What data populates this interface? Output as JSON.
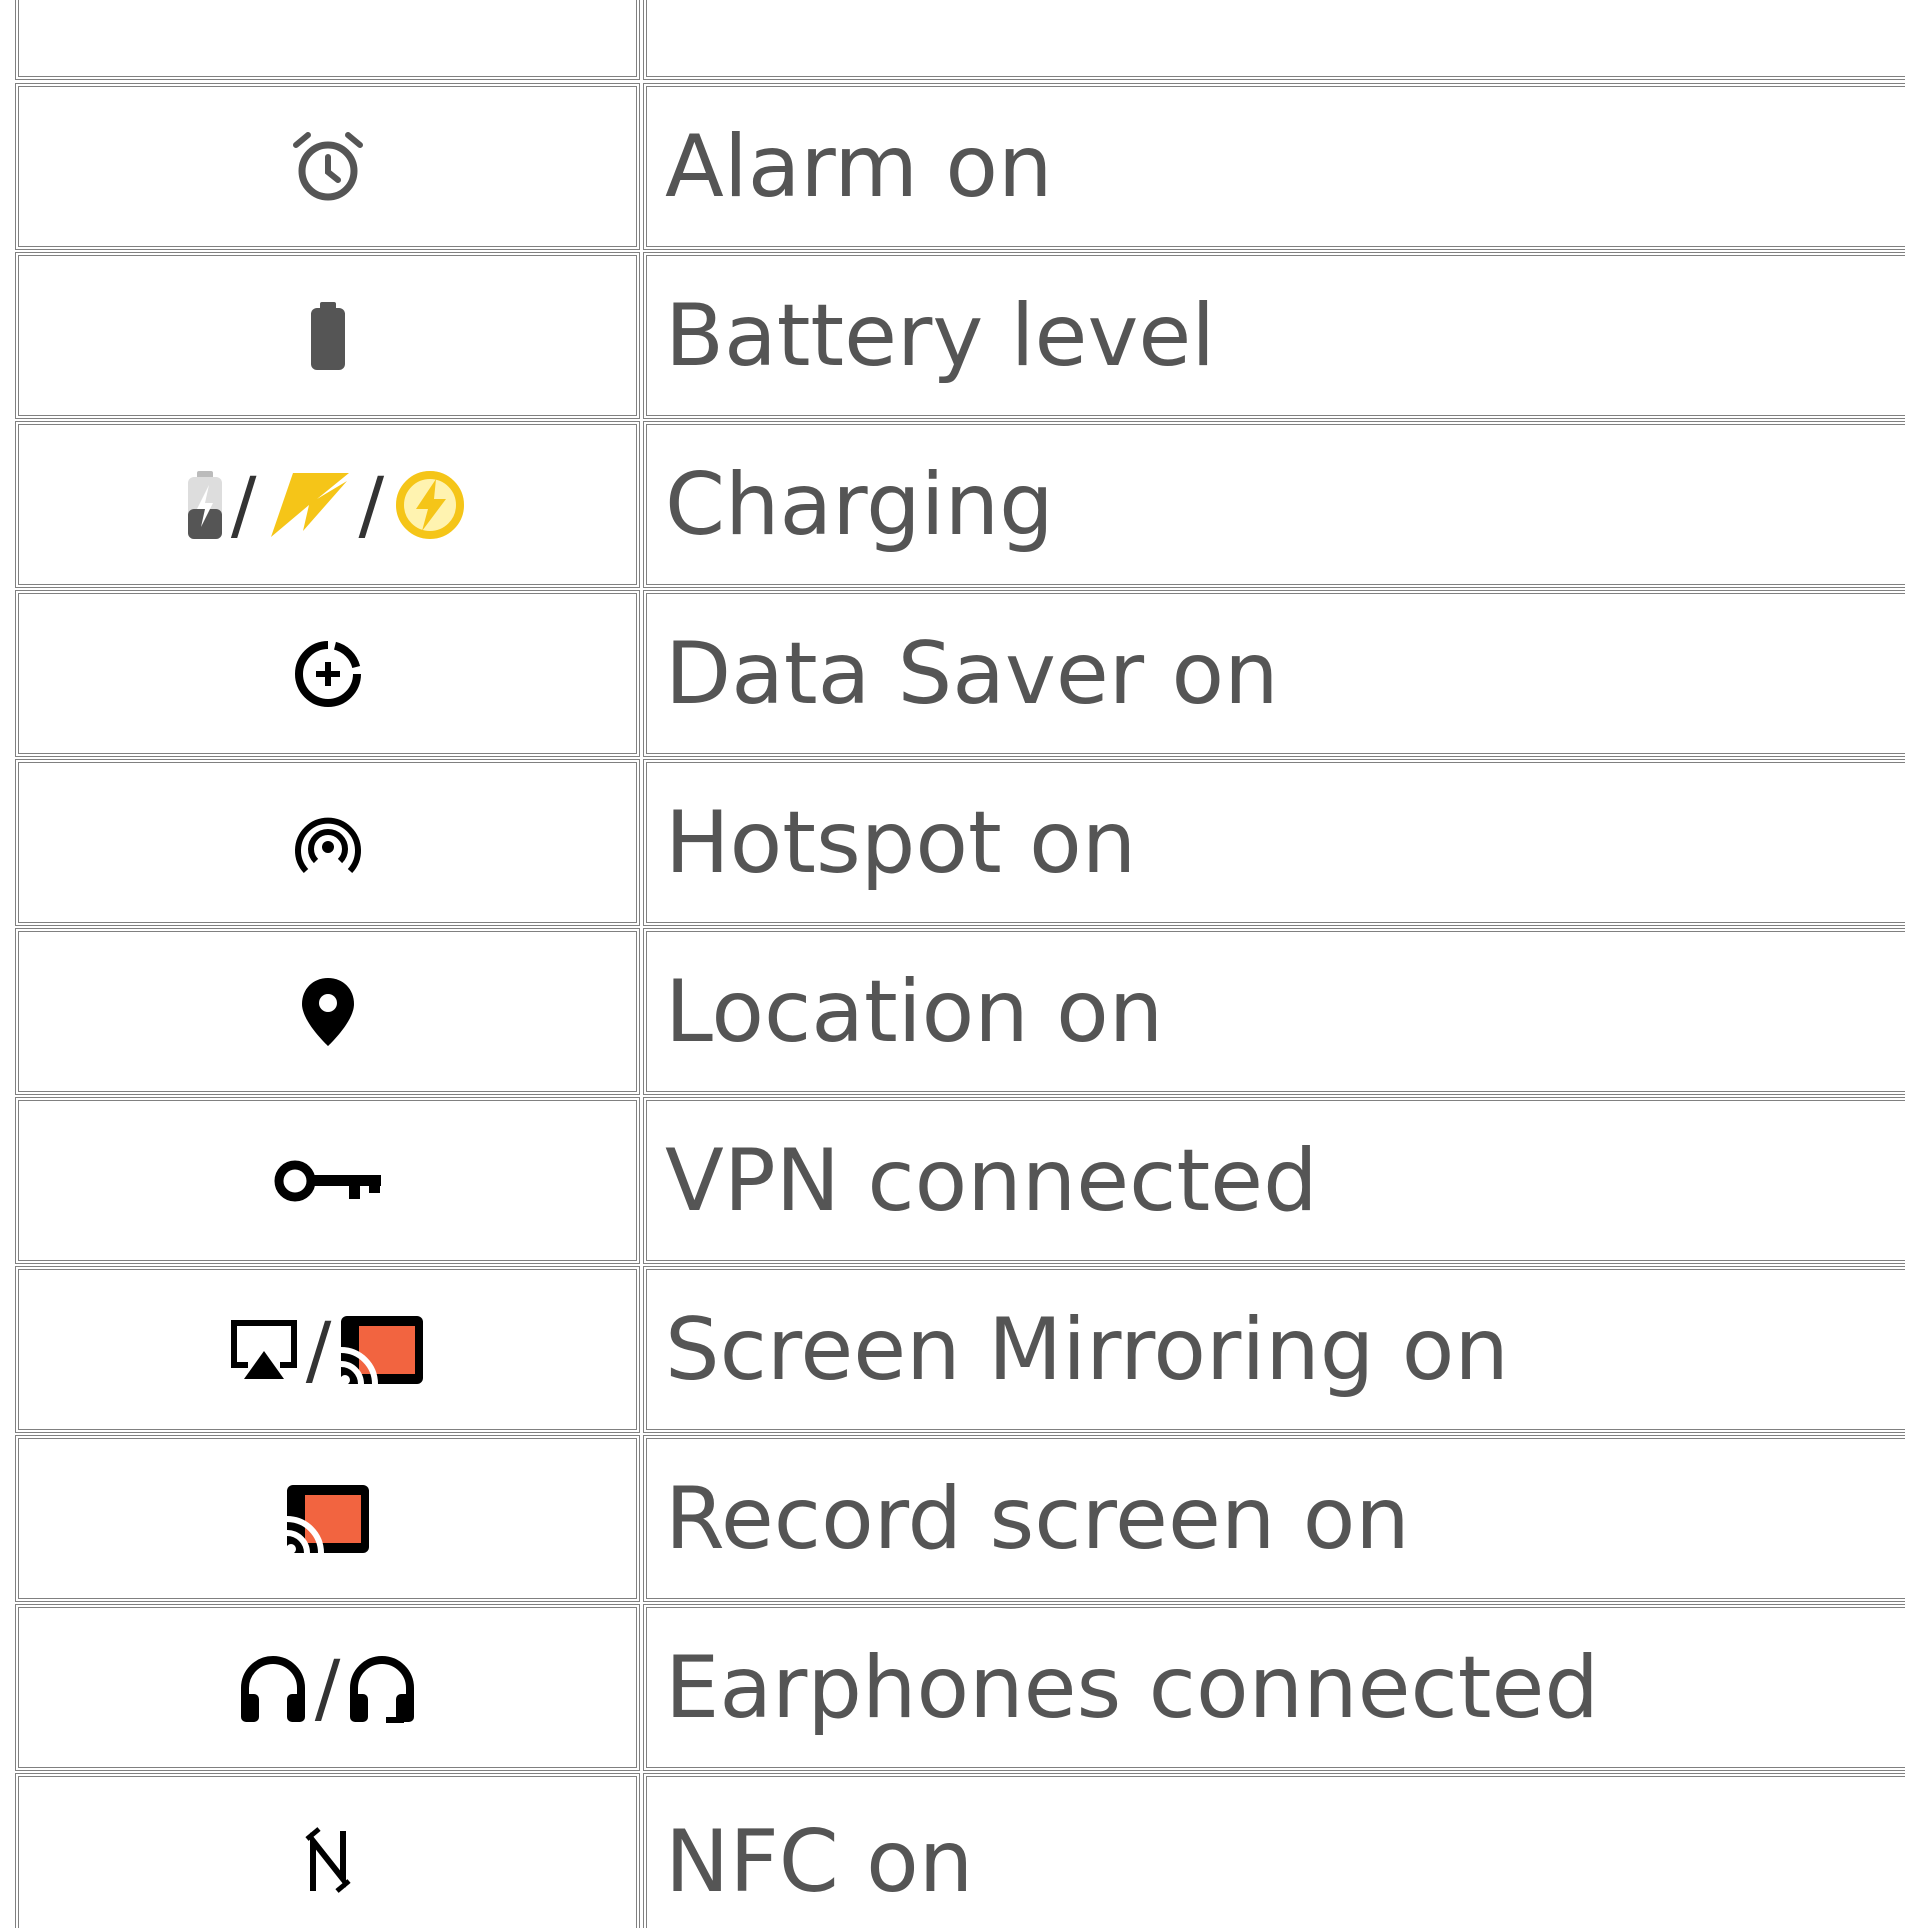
{
  "rows": [
    {
      "label": ""
    },
    {
      "label": "Alarm on",
      "icons": [
        "alarm-icon"
      ]
    },
    {
      "label": "Battery level",
      "icons": [
        "battery-icon"
      ]
    },
    {
      "label": "Charging",
      "icons": [
        "battery-charging-icon",
        "lightning-icon",
        "charging-circle-icon"
      ],
      "separator": "/"
    },
    {
      "label": "Data Saver on",
      "icons": [
        "data-saver-icon"
      ]
    },
    {
      "label": "Hotspot on",
      "icons": [
        "hotspot-icon"
      ]
    },
    {
      "label": "Location on",
      "icons": [
        "location-pin-icon"
      ]
    },
    {
      "label": "VPN connected",
      "icons": [
        "vpn-key-icon"
      ]
    },
    {
      "label": "Screen Mirroring on",
      "icons": [
        "airplay-icon",
        "cast-icon"
      ],
      "separator": "/"
    },
    {
      "label": "Record screen on",
      "icons": [
        "cast-icon"
      ]
    },
    {
      "label": "Earphones connected",
      "icons": [
        "headphones-icon",
        "headset-icon"
      ],
      "separator": "/"
    },
    {
      "label": "NFC on",
      "icons": [
        "nfc-icon"
      ]
    }
  ],
  "colors": {
    "text": "#555555",
    "border": "#808080",
    "icon_dark": "#000000",
    "icon_gray": "#555555",
    "charging_yellow": "#f5c518",
    "cast_orange": "#f26440"
  }
}
